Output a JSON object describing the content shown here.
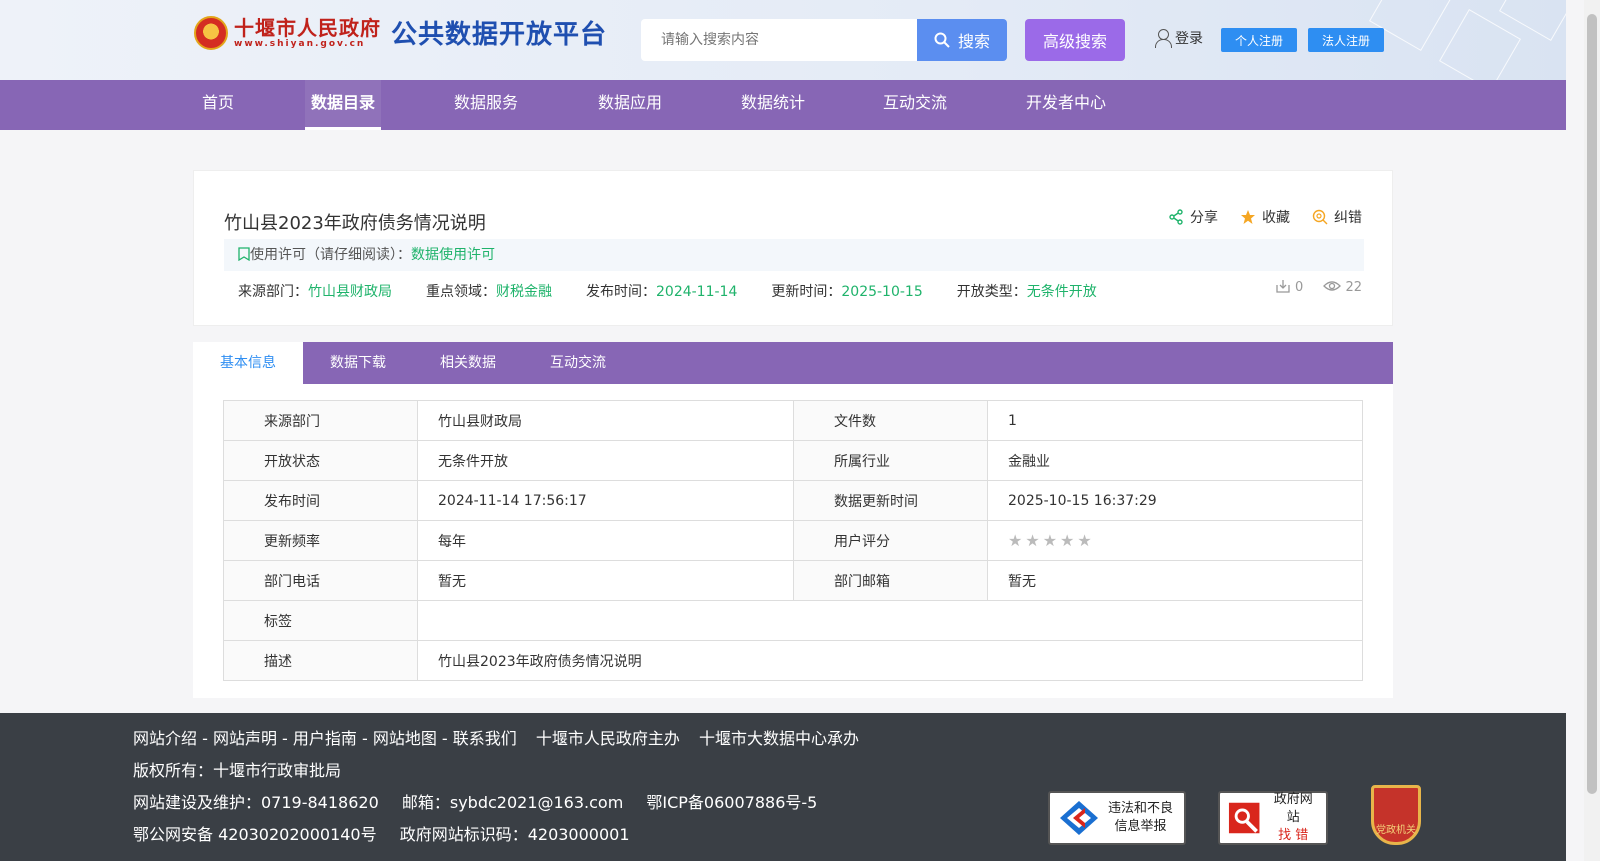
{
  "header": {
    "logo_cn": "十堰市人民政府",
    "logo_en": "www.shiyan.gov.cn",
    "platform": "公共数据开放平台",
    "search_placeholder": "请输入搜索内容",
    "search_label": "搜索",
    "advanced_label": "高级搜索",
    "login_label": "登录",
    "personal_register": "个人注册",
    "corporate_register": "法人注册"
  },
  "nav": {
    "items": [
      {
        "label": "首页"
      },
      {
        "label": "数据目录"
      },
      {
        "label": "数据服务"
      },
      {
        "label": "数据应用"
      },
      {
        "label": "数据统计"
      },
      {
        "label": "互动交流"
      },
      {
        "label": "开发者中心"
      }
    ],
    "active": "数据目录"
  },
  "dataset": {
    "title": "竹山县2023年政府债务情况说明",
    "actions": {
      "share": "分享",
      "favorite": "收藏",
      "report": "纠错"
    },
    "license_prefix": "使用许可（请仔细阅读）：",
    "license_link": "数据使用许可",
    "meta": [
      {
        "label": "来源部门：",
        "value": "竹山县财政局"
      },
      {
        "label": "重点领域：",
        "value": "财税金融"
      },
      {
        "label": "发布时间：",
        "value": "2024-11-14"
      },
      {
        "label": "更新时间：",
        "value": "2025-10-15"
      },
      {
        "label": "开放类型：",
        "value": "无条件开放"
      }
    ],
    "downloads": "0",
    "views": "22"
  },
  "tabs": [
    {
      "label": "基本信息"
    },
    {
      "label": "数据下载"
    },
    {
      "label": "相关数据"
    },
    {
      "label": "互动交流"
    }
  ],
  "info": {
    "rows": [
      {
        "l1": "来源部门",
        "v1": "竹山县财政局",
        "l2": "文件数",
        "v2": "1"
      },
      {
        "l1": "开放状态",
        "v1": "无条件开放",
        "l2": "所属行业",
        "v2": "金融业"
      },
      {
        "l1": "发布时间",
        "v1": "2024-11-14 17:56:17",
        "l2": "数据更新时间",
        "v2": "2025-10-15 16:37:29"
      },
      {
        "l1": "更新频率",
        "v1": "每年",
        "l2": "用户评分",
        "v2": ""
      },
      {
        "l1": "部门电话",
        "v1": "暂无",
        "l2": "部门邮箱",
        "v2": "暂无"
      }
    ],
    "tag_label": "标签",
    "tag_value": "",
    "desc_label": "描述",
    "desc_value": "竹山县2023年政府债务情况说明",
    "rating": 0
  },
  "footer": {
    "links": "网站介绍 - 网站声明 - 用户指南 - 网站地图 - 联系我们",
    "host": "十堰市人民政府主办",
    "undertaker": "十堰市大数据中心承办",
    "copyright": "版权所有：十堰市行政审批局",
    "maintenance": "网站建设及维护：0719-8418620",
    "email": "邮箱：sybdc2021@163.com",
    "icp": "鄂ICP备06007886号-5",
    "police": "鄂公网安备 42030202000140号",
    "site_id": "政府网站标识码：4203000001",
    "badge1": [
      "违法和不良",
      "信息举报"
    ],
    "badge2": [
      "政府网站",
      "找 错"
    ],
    "badge3": "党政机关"
  },
  "colors": {
    "nav_bg": "#8766b5",
    "accent_green": "#1fb36b",
    "search_blue": "#5b8ef0",
    "advanced_purple": "#9b6ae8",
    "register_blue": "#2e8ef2",
    "footer_bg": "#3a3f45"
  }
}
